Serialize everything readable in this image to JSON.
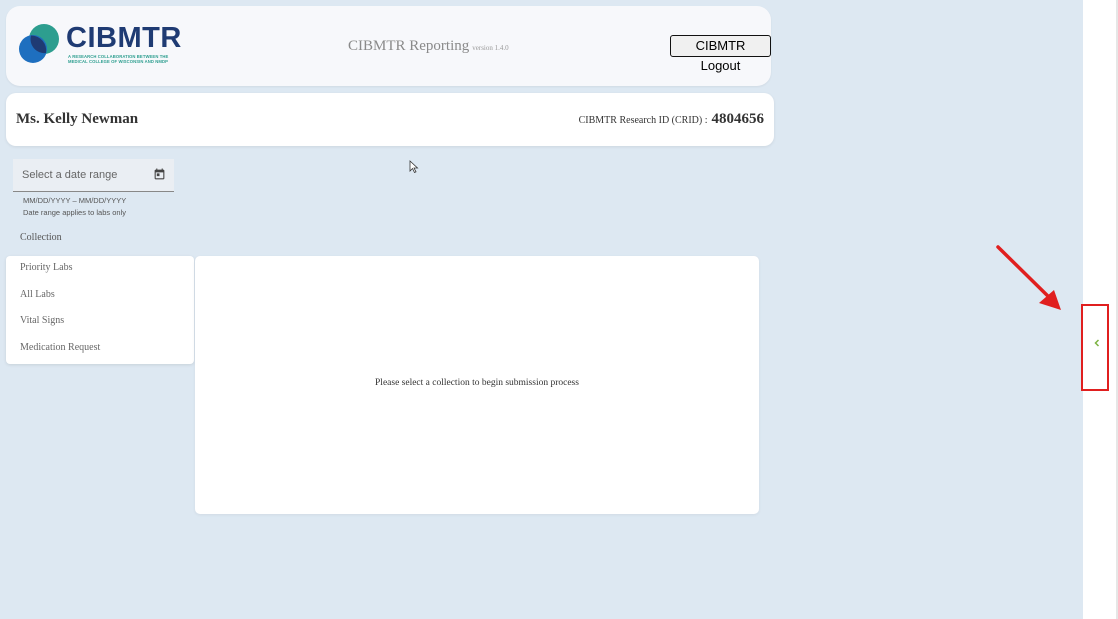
{
  "header": {
    "logo_text": "CIBMTR",
    "logo_tagline": "A RESEARCH COLLABORATION BETWEEN THE MEDICAL COLLEGE OF WISCONSIN AND NMDP",
    "app_title": "CIBMTR Reporting",
    "version": "version 1.4.0",
    "logout_label": "CIBMTR Logout"
  },
  "patient": {
    "name": "Ms. Kelly Newman",
    "crid_label": "CIBMTR Research ID (CRID) :",
    "crid_value": "4804656"
  },
  "filters": {
    "date_range_placeholder": "Select a date range",
    "date_format_hint": "MM/DD/YYYY – MM/DD/YYYY",
    "date_range_note": "Date range applies to labs only",
    "calendar_icon": "calendar-icon"
  },
  "collection": {
    "label": "Collection",
    "items": [
      {
        "label": "Priority Labs"
      },
      {
        "label": "All Labs"
      },
      {
        "label": "Vital Signs"
      },
      {
        "label": "Medication Request"
      }
    ]
  },
  "main": {
    "empty_message": "Please select a collection to begin submission process"
  },
  "side_panel": {
    "toggle_icon": "chevron-left-icon"
  },
  "colors": {
    "background": "#dde8f2",
    "brand_navy": "#1f3b73",
    "brand_teal": "#2d9e8f",
    "toggle_green": "#7cb342",
    "annotation_red": "#e01f1f"
  }
}
